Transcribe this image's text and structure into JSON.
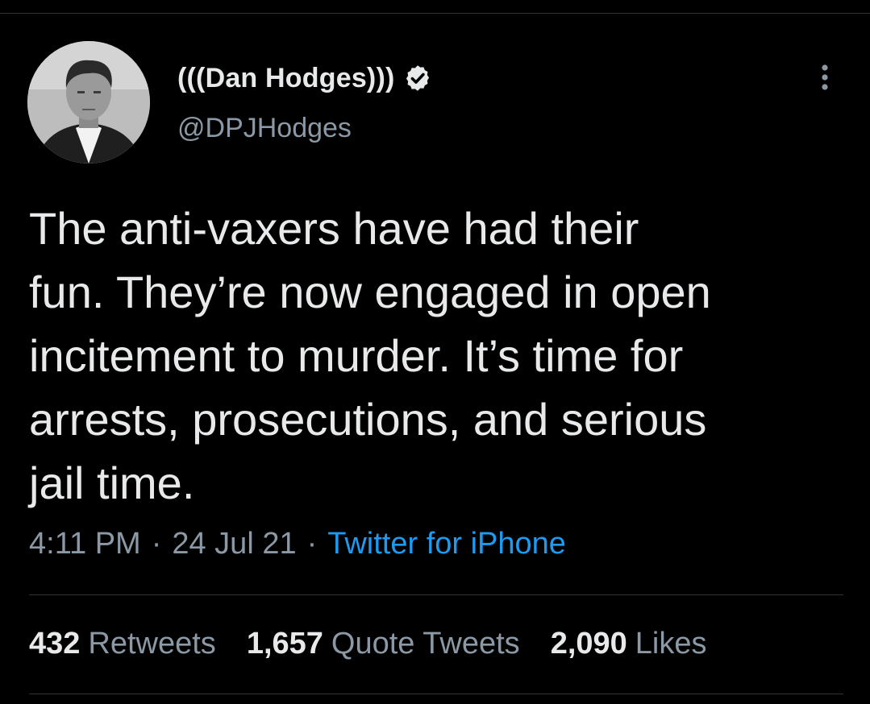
{
  "author": {
    "display_name": "(((Dan Hodges)))",
    "handle": "@DPJHodges",
    "verified_icon": "verified-badge-icon",
    "avatar": "profile-photo"
  },
  "tweet": {
    "text_lines": [
      "The anti-vaxers have had their",
      "fun. They’re now engaged in open",
      "incitement to murder. It’s time for",
      "arrests, prosecutions, and serious",
      "jail time."
    ]
  },
  "meta": {
    "time": "4:11 PM",
    "separator": "·",
    "date": "24 Jul 21",
    "source": "Twitter for iPhone"
  },
  "stats": {
    "retweets_count": "432",
    "retweets_label": "Retweets",
    "quotes_count": "1,657",
    "quotes_label": "Quote Tweets",
    "likes_count": "2,090",
    "likes_label": "Likes"
  },
  "colors": {
    "background": "#000000",
    "text": "#e7e9ea",
    "secondary": "#8b98a5",
    "link": "#1d9bf0",
    "divider": "#2f3336"
  },
  "icons": {
    "more": "more-vertical-icon"
  }
}
